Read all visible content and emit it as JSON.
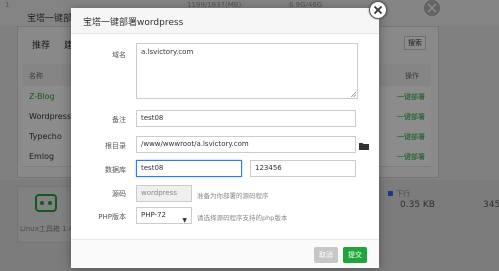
{
  "background": {
    "title": "宝塔一键部",
    "stats": [
      "1",
      "1199/1837(MB)",
      "6.9G/46G"
    ],
    "tabs": [
      "推荐",
      "建"
    ],
    "search_label": "搜索",
    "table": {
      "col_name": "名称",
      "col_action": "操作",
      "rows": [
        {
          "name": "Z-Blog",
          "action": "一键部署"
        },
        {
          "name": "Wordpress",
          "action": "一键部署"
        },
        {
          "name": "Typecho",
          "action": "一键部署"
        },
        {
          "name": "Emlog",
          "action": "一键部署"
        }
      ]
    },
    "lower": {
      "left_label": "Linux工具箱 1.4",
      "mid_label": "下行",
      "mid_value": "0.35 KB",
      "right_value": "345."
    }
  },
  "modal": {
    "title": "宝塔一键部署wordpress",
    "fields": {
      "domain_label": "域名",
      "domain_value": "a.lsvictory.com",
      "note_label": "备注",
      "note_value": "test08",
      "root_label": "根目录",
      "root_value": "/www/wwwroot/a.lsvictory.com",
      "db_label": "数据库",
      "db_name": "test08",
      "db_password": "123456",
      "source_label": "源码",
      "source_value": "wordpress",
      "source_hint": "准备为你部署的源码程序",
      "php_label": "PHP版本",
      "php_selected": "PHP-72",
      "php_hint": "请选择源码程序支持的php版本"
    },
    "buttons": {
      "cancel": "取消",
      "submit": "提交"
    }
  },
  "colors": {
    "accent_green": "#20a53a",
    "focus_blue": "#2f7fd8"
  },
  "icons": {
    "close": "close-icon",
    "folder": "folder-icon",
    "dropdown": "chevron-down-icon"
  }
}
